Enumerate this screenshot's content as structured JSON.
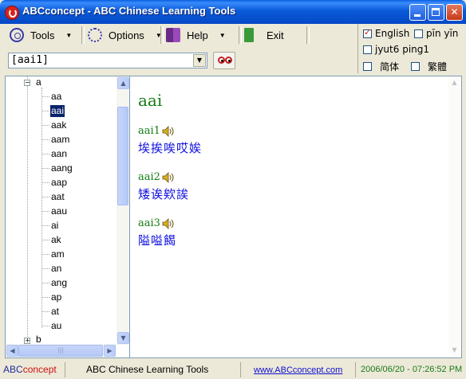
{
  "window": {
    "title": "ABCconcept - ABC Chinese Learning Tools"
  },
  "toolbar": {
    "tools_label": "Tools",
    "options_label": "Options",
    "help_label": "Help",
    "exit_label": "Exit",
    "search_value": "[aai1]"
  },
  "options": {
    "english": {
      "label": "English",
      "checked": true
    },
    "pinyin": {
      "label": "pīn yīn",
      "checked": false
    },
    "jyutping": {
      "label": "jyut6 ping1",
      "checked": false
    },
    "simplified": {
      "label": "简体",
      "checked": false
    },
    "traditional": {
      "label": "繁體",
      "checked": false
    }
  },
  "tree": {
    "root_a": "a",
    "items": [
      "aa",
      "aai",
      "aak",
      "aam",
      "aan",
      "aang",
      "aap",
      "aat",
      "aau",
      "ai",
      "ak",
      "am",
      "an",
      "ang",
      "ap",
      "at",
      "au"
    ],
    "selected": "aai",
    "root_b": "b"
  },
  "content": {
    "heading": "aai",
    "entries": [
      {
        "syllable": "aai1",
        "chars": "埃挨唉哎娭"
      },
      {
        "syllable": "aai2",
        "chars": "矮诶欸誒"
      },
      {
        "syllable": "aai3",
        "chars": "隘嗌餲"
      }
    ]
  },
  "status": {
    "logo_part1": "ABC",
    "logo_part2": "concept",
    "app_name": "ABC Chinese Learning Tools",
    "url": "www.ABCconcept.com",
    "timestamp": "2006/06/20 - 07:26:52 PM"
  },
  "colors": {
    "title_bar": "#0a5ad8",
    "heading_green": "#137d13",
    "chars_blue": "#1010e0",
    "selection": "#0a246a"
  }
}
